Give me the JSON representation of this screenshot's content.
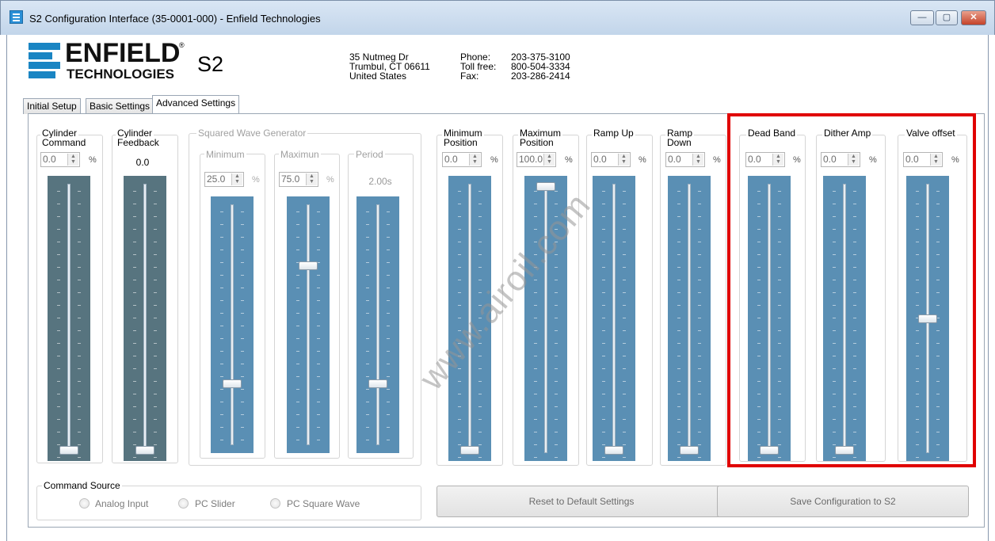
{
  "window": {
    "title": "S2 Configuration Interface (35-0001-000) - Enfield Technologies",
    "min_glyph": "—",
    "max_glyph": "▢",
    "close_glyph": "✕"
  },
  "header": {
    "logo_word": "ENFIELD",
    "logo_reg": "®",
    "logo_sub": "TECHNOLOGIES",
    "model": "S2",
    "address": [
      "35 Nutmeg Dr",
      "Trumbul, CT 06611",
      "United States"
    ],
    "contact_labels": [
      "Phone:",
      "Toll free:",
      "Fax:"
    ],
    "contact_values": [
      "203-375-3100",
      "800-504-3334",
      "203-286-2414"
    ]
  },
  "tabs": [
    "Initial Setup",
    "Basic Settings",
    "Advanced Settings"
  ],
  "active_tab": 2,
  "controls": {
    "cylinder_command": {
      "label_1": "Cylinder",
      "label_2": "Command",
      "value": "0.0",
      "unit": "%",
      "level": 0
    },
    "cylinder_feedback": {
      "label_1": "Cylinder",
      "label_2": "Feedback",
      "value": "0.0",
      "level": 0
    },
    "squared_wave": {
      "title": "Squared Wave Generator",
      "minimum": {
        "label": "Minimum",
        "value": "25.0",
        "unit": "%",
        "level": 0.25
      },
      "maximum": {
        "label": "Maximun",
        "value": "75.0",
        "unit": "%",
        "level": 0.75
      },
      "period": {
        "label": "Period",
        "value": "2.00s",
        "level": 0.25
      }
    },
    "minimum_position": {
      "label_1": "Minimum",
      "label_2": "Position",
      "value": "0.0",
      "unit": "%",
      "level": 0
    },
    "maximum_position": {
      "label_1": "Maximum",
      "label_2": "Position",
      "value": "100.0",
      "unit": "%",
      "level": 1
    },
    "ramp_up": {
      "label": "Ramp Up",
      "value": "0.0",
      "unit": "%",
      "level": 0
    },
    "ramp_down": {
      "label_1": "Ramp",
      "label_2": "Down",
      "value": "0.0",
      "unit": "%",
      "level": 0
    },
    "dead_band": {
      "label": "Dead Band",
      "value": "0.0",
      "unit": "%",
      "level": 0
    },
    "dither_amp": {
      "label": "Dither Amp",
      "value": "0.0",
      "unit": "%",
      "level": 0
    },
    "valve_offset": {
      "label": "Valve offset",
      "value": "0.0",
      "unit": "%",
      "level": 0.5
    }
  },
  "command_source": {
    "title": "Command Source",
    "options": [
      "Analog Input",
      "PC Slider",
      "PC Square Wave"
    ]
  },
  "buttons": {
    "reset": "Reset to Default Settings",
    "save": "Save Configuration to S2"
  },
  "watermark": "www.airoil.com",
  "colors": {
    "slider_dark": "#57747f",
    "slider_blue": "#5a8fb4",
    "highlight": "#e00000",
    "logo_blue": "#1a85c3"
  }
}
